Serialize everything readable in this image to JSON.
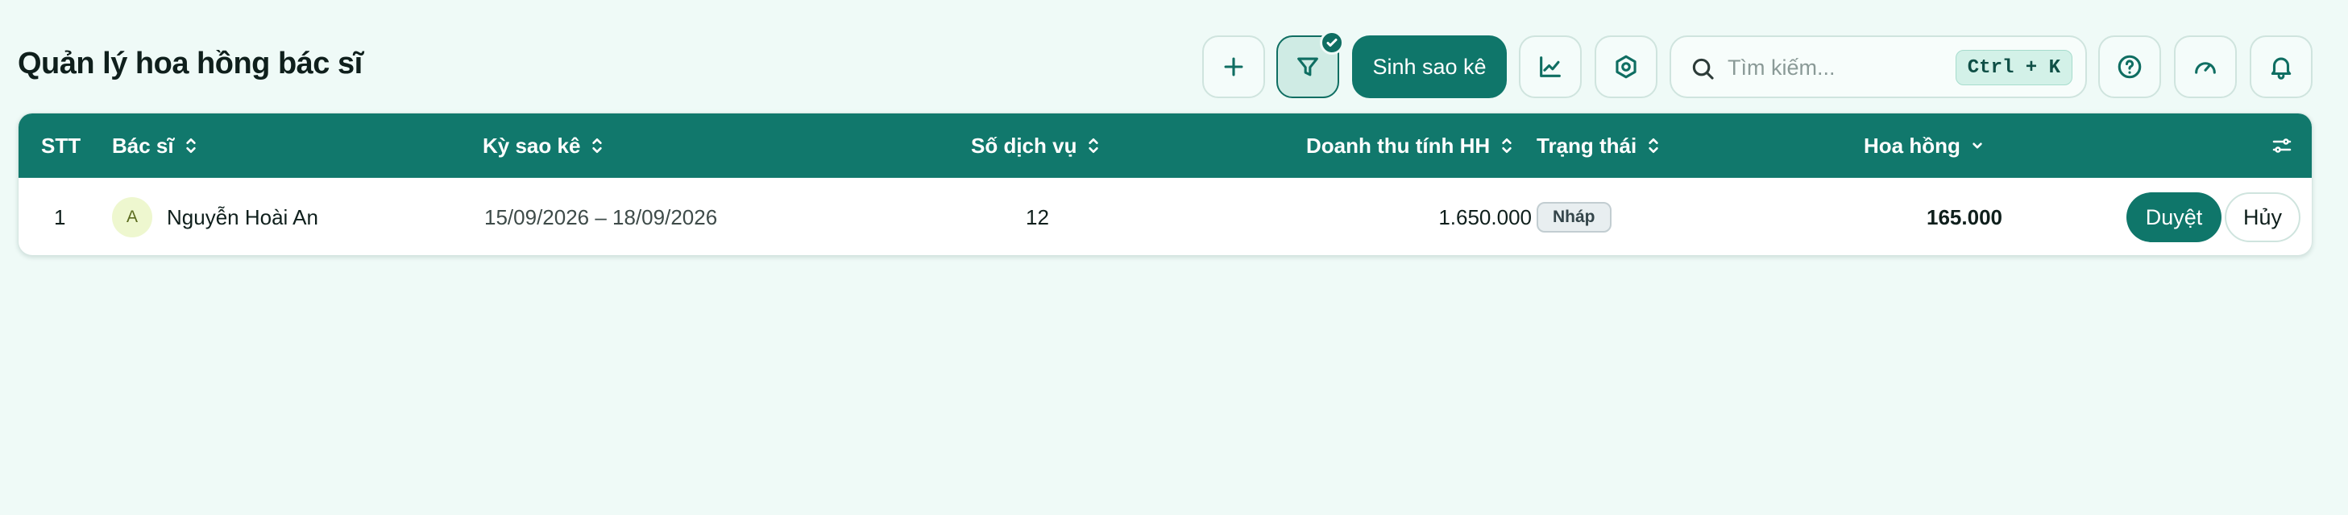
{
  "page": {
    "title": "Quản lý hoa hồng bác sĩ"
  },
  "toolbar": {
    "add_icon": "plus-icon",
    "filter_icon": "filter-icon",
    "filter_active": true,
    "generate_label": "Sinh sao kê",
    "chart_icon": "line-chart-icon",
    "settings_icon": "hexagon-settings-icon",
    "help_icon": "help-circle-icon",
    "dashboard_icon": "gauge-icon",
    "notify_icon": "bell-icon"
  },
  "search": {
    "placeholder": "Tìm kiếm...",
    "value": "",
    "shortcut": "Ctrl + K"
  },
  "table": {
    "columns": {
      "stt": "STT",
      "doctor": "Bác sĩ",
      "period": "Kỳ sao kê",
      "services": "Số dịch vụ",
      "revenue": "Doanh thu tính HH",
      "status": "Trạng thái",
      "commission": "Hoa hồng"
    },
    "rows": [
      {
        "stt": "1",
        "avatar_initial": "A",
        "doctor": "Nguyễn Hoài An",
        "period": "15/09/2026 – 18/09/2026",
        "services": "12",
        "revenue": "1.650.000",
        "status": "Nháp",
        "commission": "165.000",
        "approve_label": "Duyệt",
        "cancel_label": "Hủy"
      }
    ]
  },
  "colors": {
    "accent": "#0f766a",
    "header_bg": "#11786c",
    "page_bg": "#effaf7"
  }
}
